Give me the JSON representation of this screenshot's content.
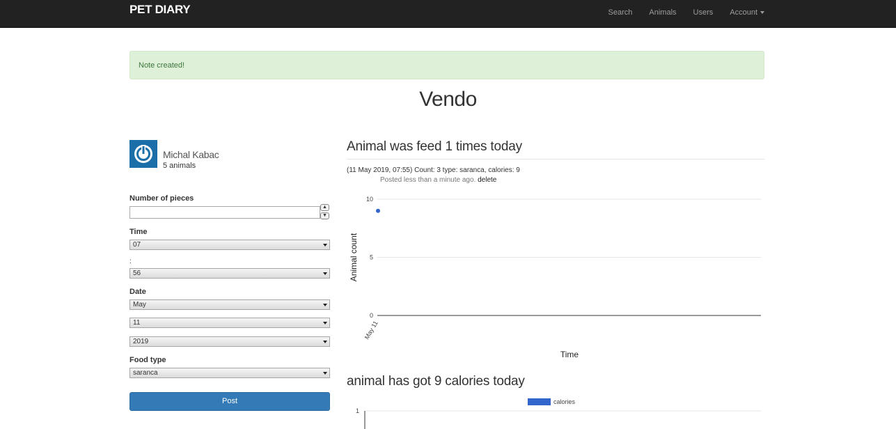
{
  "navbar": {
    "brand": "PET DIARY",
    "links": [
      "Search",
      "Animals",
      "Users",
      "Account"
    ]
  },
  "alert": {
    "message": "Note created!"
  },
  "page": {
    "title": "Vendo"
  },
  "profile": {
    "name": "Michal Kabac",
    "subtitle": "5 animals"
  },
  "form": {
    "pieces_label": "Number of pieces",
    "pieces_value": "",
    "time_label": "Time",
    "hour": "07",
    "colon": ":",
    "minute": "56",
    "date_label": "Date",
    "month": "May",
    "day": "11",
    "year": "2019",
    "food_label": "Food type",
    "food": "saranca",
    "post_label": "Post"
  },
  "feed": {
    "heading": "Animal was feed 1 times today",
    "entry": "(11 May 2019, 07:55) Count: 3 type: saranca, calories: 9",
    "posted": "Posted less than a minute ago.",
    "delete_label": "delete"
  },
  "calories": {
    "heading": "animal has got 9 calories today"
  },
  "chart_data": [
    {
      "type": "scatter",
      "title": "",
      "xlabel": "Time",
      "ylabel": "Animal count",
      "x": [
        "May 11"
      ],
      "y": [
        9
      ],
      "ylim": [
        0,
        10
      ],
      "yticks": [
        0,
        5,
        10
      ],
      "color": "#3366cc",
      "grid": true
    },
    {
      "type": "bar",
      "title": "",
      "series": [
        {
          "name": "calories",
          "values": []
        }
      ],
      "yticks": [
        1
      ],
      "legend": "top",
      "color": "#3366cc"
    }
  ]
}
